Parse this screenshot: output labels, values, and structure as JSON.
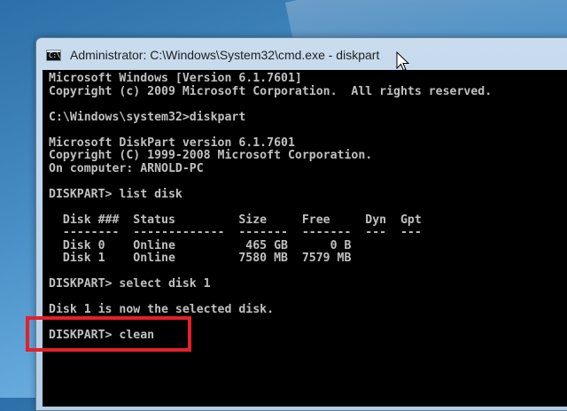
{
  "window": {
    "title": "Administrator: C:\\Windows\\System32\\cmd.exe - diskpart",
    "icon_label": "C:\\"
  },
  "console": {
    "lines": [
      "Microsoft Windows [Version 6.1.7601]",
      "Copyright (c) 2009 Microsoft Corporation.  All rights reserved.",
      "",
      "C:\\Windows\\system32>diskpart",
      "",
      "Microsoft DiskPart version 6.1.7601",
      "Copyright (C) 1999-2008 Microsoft Corporation.",
      "On computer: ARNOLD-PC",
      "",
      "DISKPART> list disk",
      "",
      "  Disk ###  Status         Size     Free     Dyn  Gpt",
      "  --------  -------------  -------  -------  ---  ---",
      "  Disk 0    Online          465 GB      0 B",
      "  Disk 1    Online         7580 MB  7579 MB",
      "",
      "DISKPART> select disk 1",
      "",
      "Disk 1 is now the selected disk.",
      "",
      "DISKPART> clean"
    ]
  },
  "colors": {
    "console_background": "#000000",
    "console_text": "#c0c0c0",
    "highlight_border": "#e4202b"
  }
}
